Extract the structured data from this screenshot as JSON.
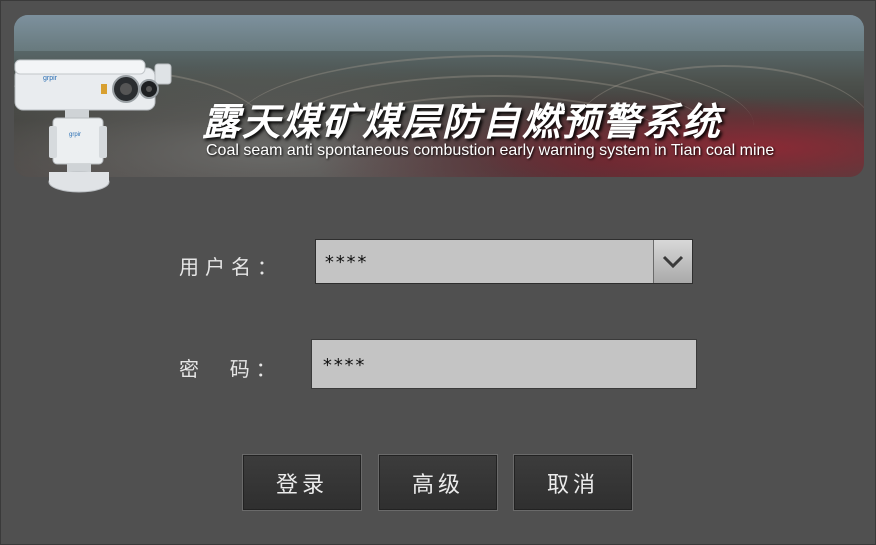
{
  "banner": {
    "title_cn": "露天煤矿煤层防自燃预警系统",
    "title_en": "Coal seam anti spontaneous combustion early warning system in Tian coal mine",
    "camera_icon": "thermal-camera-icon"
  },
  "form": {
    "username_label": "用户名：",
    "username_value": "****",
    "password_label": "密  码：",
    "password_value": "****"
  },
  "buttons": {
    "login": "登录",
    "advanced": "高级",
    "cancel": "取消"
  },
  "colors": {
    "background": "#505050",
    "field": "#c4c4c4",
    "button": "#353535",
    "text": "#e6e6e6"
  }
}
